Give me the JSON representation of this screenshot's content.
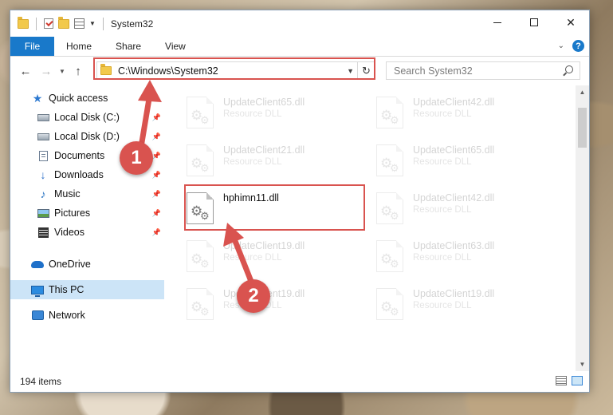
{
  "window": {
    "title": "System32",
    "minimize_glyph": "—",
    "close_glyph": "✕"
  },
  "ribbon": {
    "tabs": [
      "File",
      "Home",
      "Share",
      "View"
    ],
    "help": "?"
  },
  "address": {
    "path": "C:\\Windows\\System32",
    "refresh_glyph": "↻"
  },
  "search": {
    "placeholder": "Search System32"
  },
  "nav": {
    "back": "←",
    "forward": "→",
    "recent": "⌄",
    "up": "↑",
    "items": [
      {
        "label": "Quick access",
        "icon": "star-icon",
        "pinned": false
      },
      {
        "label": "Local Disk (C:)",
        "icon": "drive-icon",
        "pinned": true
      },
      {
        "label": "Local Disk (D:)",
        "icon": "drive-icon",
        "pinned": true
      },
      {
        "label": "Documents",
        "icon": "documents-icon",
        "pinned": true
      },
      {
        "label": "Downloads",
        "icon": "download-icon",
        "pinned": true
      },
      {
        "label": "Music",
        "icon": "music-icon",
        "pinned": true
      },
      {
        "label": "Pictures",
        "icon": "pictures-icon",
        "pinned": true
      },
      {
        "label": "Videos",
        "icon": "videos-icon",
        "pinned": true
      },
      {
        "label": "OneDrive",
        "icon": "onedrive-icon",
        "pinned": false
      },
      {
        "label": "This PC",
        "icon": "this-pc-icon",
        "pinned": false,
        "selected": true
      },
      {
        "label": "Network",
        "icon": "network-icon",
        "pinned": false
      }
    ]
  },
  "files": [
    {
      "name": "UpdateClient65.dll",
      "type": "Resource DLL",
      "faded": true
    },
    {
      "name": "UpdateClient42.dll",
      "type": "Resource DLL",
      "faded": true
    },
    {
      "name": "UpdateClient21.dll",
      "type": "Resource DLL",
      "faded": true
    },
    {
      "name": "UpdateClient65.dll",
      "type": "Resource DLL",
      "faded": true
    },
    {
      "name": "hphimn11.dll",
      "type": "",
      "faded": false
    },
    {
      "name": "UpdateClient42.dll",
      "type": "Resource DLL",
      "faded": true
    },
    {
      "name": "UpdateClient19.dll",
      "type": "Resource DLL",
      "faded": true
    },
    {
      "name": "UpdateClient63.dll",
      "type": "Resource DLL",
      "faded": true
    },
    {
      "name": "UpdateClient19.dll",
      "type": "Resource DLL",
      "faded": true
    },
    {
      "name": "UpdateClient19.dll",
      "type": "Resource DLL",
      "faded": true
    }
  ],
  "status": {
    "item_count": "194 items"
  },
  "callouts": {
    "one": "1",
    "two": "2"
  },
  "colors": {
    "accent": "#1979ca",
    "annotation": "#d9534f",
    "selection": "#cce4f7"
  }
}
